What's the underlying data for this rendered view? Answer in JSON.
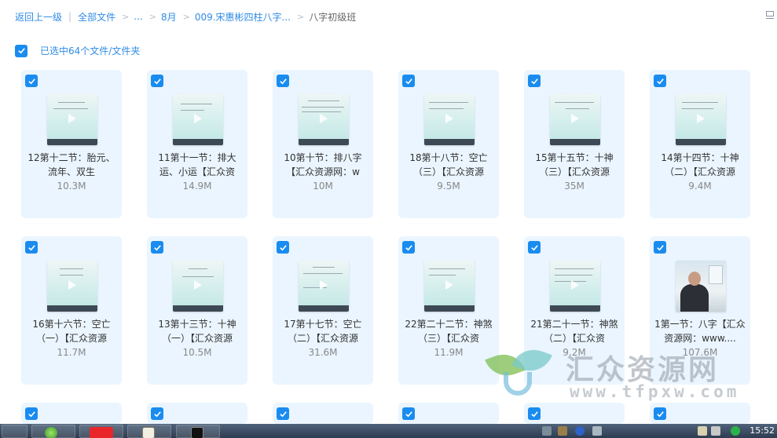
{
  "breadcrumb": {
    "back": "返回上一级",
    "all_files": "全部文件",
    "ellipsis": "...",
    "month": "8月",
    "course": "009.宋惠彬四柱八字...",
    "current": "八字初级班"
  },
  "selection": {
    "text": "已选中64个文件/文件夹"
  },
  "files": [
    {
      "name": "12第十二节：胎元、流年、双生",
      "size": "10.3M"
    },
    {
      "name": "11第十一节：排大运、小运【汇众资",
      "size": "14.9M"
    },
    {
      "name": "10第十节：排八字【汇众资源网：w",
      "size": "10M"
    },
    {
      "name": "18第十八节：空亡（三）【汇众资源",
      "size": "9.5M"
    },
    {
      "name": "15第十五节：十神（三）【汇众资源",
      "size": "35M"
    },
    {
      "name": "14第十四节：十神（二）【汇众资源",
      "size": "9.4M"
    },
    {
      "name": "16第十六节：空亡（一）【汇众资源",
      "size": "11.7M"
    },
    {
      "name": "13第十三节：十神（一）【汇众资源",
      "size": "10.5M"
    },
    {
      "name": "17第十七节：空亡（二）【汇众资源",
      "size": "31.6M"
    },
    {
      "name": "22第二十二节：神煞（三）【汇众资",
      "size": "11.9M"
    },
    {
      "name": "21第二十一节：神煞（二）【汇众资",
      "size": "9.2M"
    },
    {
      "name": "1第一节：八字【汇众资源网：www....",
      "size": "107.6M"
    }
  ],
  "watermark": {
    "title": "汇众资源网",
    "url": "www.tfpxw.com"
  },
  "taskbar": {
    "clock": "15:52"
  },
  "colors": {
    "accent": "#1a8cf0",
    "card_bg": "#eaf5ff",
    "link": "#2f8ce6"
  }
}
